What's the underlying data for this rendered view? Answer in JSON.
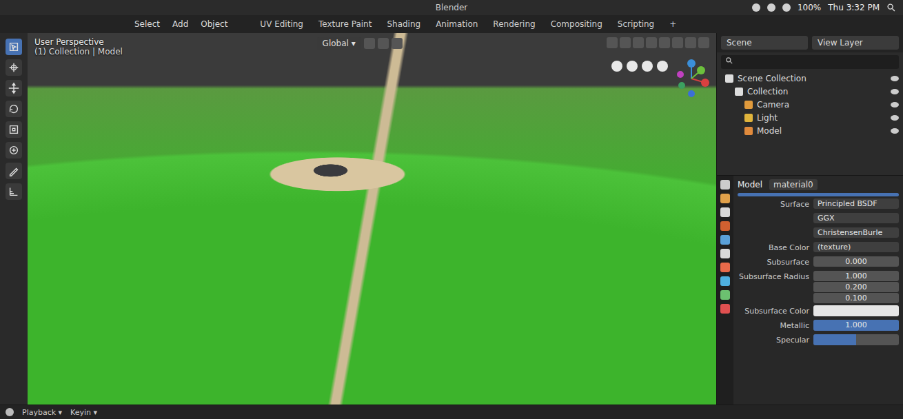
{
  "window": {
    "title": "Blender"
  },
  "system_bar": {
    "battery": "100%",
    "clock": "Thu 3:32 PM"
  },
  "menus": [
    "Select",
    "Add",
    "Object"
  ],
  "workspaces": [
    {
      "label": "UV Editing",
      "selected": false
    },
    {
      "label": "Texture Paint",
      "selected": false
    },
    {
      "label": "Shading",
      "selected": false
    },
    {
      "label": "Animation",
      "selected": false
    },
    {
      "label": "Rendering",
      "selected": false
    },
    {
      "label": "Compositing",
      "selected": false
    },
    {
      "label": "Scripting",
      "selected": false
    }
  ],
  "add_workspace": "+",
  "viewport": {
    "mode": "User Perspective",
    "context": "(1) Collection | Model",
    "orientation": "Global"
  },
  "scene": {
    "scene": "Scene",
    "view_layer": "View Layer"
  },
  "outliner": {
    "items": [
      {
        "label": "Scene Collection",
        "kind": "scene",
        "children": [
          {
            "label": "Collection",
            "kind": "collection",
            "children": [
              {
                "label": "Camera",
                "kind": "camera",
                "children": []
              },
              {
                "label": "Light",
                "kind": "light",
                "children": []
              },
              {
                "label": "Model",
                "kind": "object",
                "children": []
              }
            ]
          }
        ]
      }
    ]
  },
  "properties": {
    "object": "Model",
    "material": "material0",
    "rows": [
      {
        "label": "Surface",
        "value": "Principled BSDF",
        "kind": "dropdown"
      },
      {
        "label": "",
        "value": "GGX",
        "kind": "dropdown"
      },
      {
        "label": "",
        "value": "ChristensenBurle",
        "kind": "dropdown"
      },
      {
        "label": "Base Color",
        "value": "(texture)",
        "kind": "link"
      },
      {
        "label": "Subsurface",
        "value": "0.000",
        "kind": "number"
      },
      {
        "label": "Subsurface Radius",
        "values": [
          "1.000",
          "0.200",
          "0.100"
        ],
        "kind": "vector"
      },
      {
        "label": "Subsurface Color",
        "color": "#e6e6e6",
        "kind": "color"
      },
      {
        "label": "Metallic",
        "value": "1.000",
        "level": 1,
        "kind": "slider"
      },
      {
        "label": "Specular",
        "level": 0.5,
        "kind": "slider"
      }
    ]
  },
  "timeline": [
    "Playback",
    "Keyin"
  ]
}
